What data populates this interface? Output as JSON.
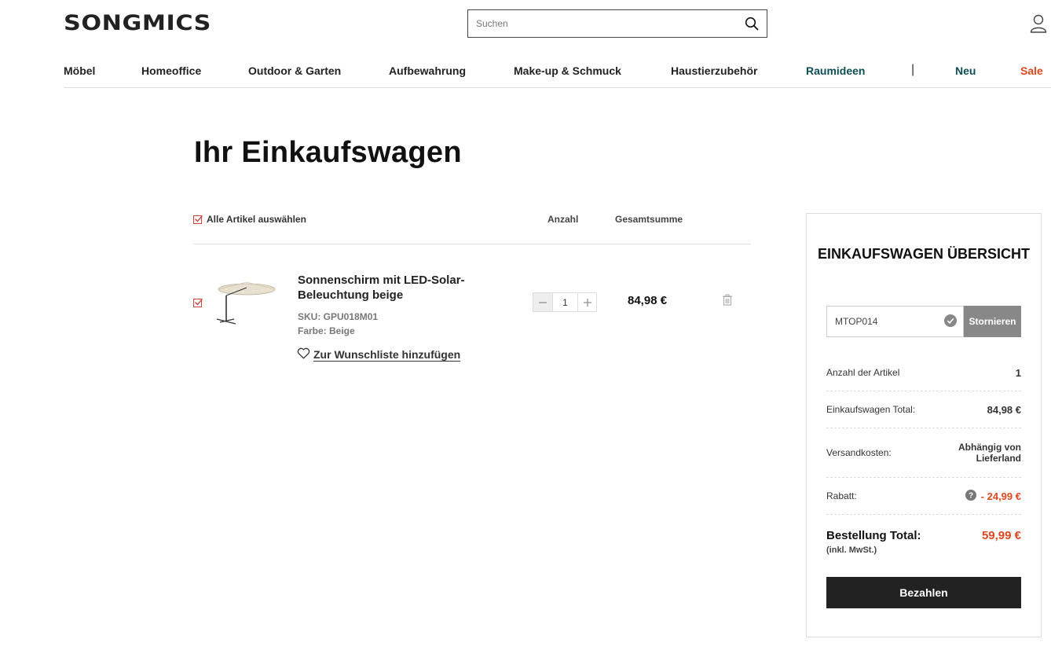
{
  "header": {
    "logo": "SONGMICS",
    "search_placeholder": "Suchen"
  },
  "nav": {
    "items": [
      "Möbel",
      "Homeoffice",
      "Outdoor & Garten",
      "Aufbewahrung",
      "Make-up & Schmuck",
      "Haustierzubehör",
      "Raumideen"
    ],
    "separator": "|",
    "new_label": "Neu",
    "sale_label": "Sale"
  },
  "page_title": "Ihr Einkaufswagen",
  "cart": {
    "select_all": "Alle Artikel auswählen",
    "col_qty": "Anzahl",
    "col_total": "Gesamtsumme",
    "items": [
      {
        "name": "Sonnenschirm mit LED-Solar-Beleuchtung beige",
        "sku": "SKU: GPU018M01",
        "color": "Farbe: Beige",
        "quantity": "1",
        "price": "84,98 €",
        "wishlist": "Zur Wunschliste hinzufügen"
      }
    ]
  },
  "summary": {
    "title": "EINKAUFSWAGEN ÜBERSICHT",
    "coupon_code": "MTOP014",
    "cancel_label": "Stornieren",
    "rows": [
      {
        "label": "Anzahl der Artikel",
        "value": "1"
      },
      {
        "label": "Einkaufswagen Total:",
        "value": "84,98 €"
      },
      {
        "label": "Versandkosten:",
        "value": "Abhängig von Lieferland"
      },
      {
        "label": "Rabatt:",
        "value": "- 24,99 €"
      }
    ],
    "total_label": "Bestellung Total:",
    "total_sub": "(inkl. MwSt.)",
    "total_value": "59,99 €",
    "pay_label": "Bezahlen"
  },
  "colors": {
    "accent_red": "#e0461c",
    "teal": "#0e4e55",
    "dark": "#222222"
  }
}
